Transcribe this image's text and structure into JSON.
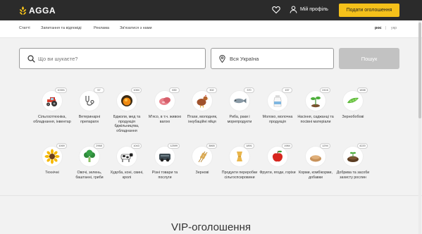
{
  "header": {
    "logo_text": "AGGA",
    "profile_label": "Мій профіль",
    "post_button": "Подати оголошення"
  },
  "subnav": {
    "links": [
      "Статті",
      "Запитання та відповіді",
      "Реклама",
      "Зв'язатися з нами"
    ],
    "languages": [
      "рос",
      "укр"
    ],
    "active_language": "рос"
  },
  "search": {
    "placeholder": "Що ви шукаєте?",
    "region_label": "Вся Україна",
    "find_button": "Пошук"
  },
  "colors": {
    "accent": "#f5c11a",
    "topbar": "#2b2b2b",
    "page_background": "#f2f2f2",
    "search_button_disabled": "#c2c2c2"
  },
  "categories": [
    {
      "label": "Сільгосптехніка, обладнання, інвентар",
      "count": "10301",
      "icon": "tractor-icon"
    },
    {
      "label": "Ветеринарні препарати",
      "count": "57",
      "icon": "stethoscope-icon"
    },
    {
      "label": "Бджоли, мед та продукція бджільництва, обладнання",
      "count": "1084",
      "icon": "honey-icon"
    },
    {
      "label": "М'ясо, в т.ч. живою вагою",
      "count": "830",
      "icon": "meat-icon"
    },
    {
      "label": "Птахи, молодняк, інкубаційні яйця",
      "count": "302",
      "icon": "chicken-icon"
    },
    {
      "label": "Риба, раки і морепродукти",
      "count": "370",
      "icon": "fish-icon"
    },
    {
      "label": "Молоко, молочна продукція",
      "count": "157",
      "icon": "milk-icon"
    },
    {
      "label": "Насіння, саджанці та посівні матеріали",
      "count": "2416",
      "icon": "seedling-icon"
    },
    {
      "label": "Зернобобові",
      "count": "1838",
      "icon": "peas-icon"
    },
    {
      "label": "Технічні",
      "count": "1069",
      "icon": "sunflower-icon"
    },
    {
      "label": "Овочі, зелень, баштанні, гриби",
      "count": "2968",
      "icon": "broccoli-icon"
    },
    {
      "label": "Худоба, коні, свині, кролі",
      "count": "1043",
      "icon": "cow-icon"
    },
    {
      "label": "Різні товари та послуги",
      "count": "12599",
      "icon": "services-icon"
    },
    {
      "label": "Зернові",
      "count": "3865",
      "icon": "wheat-icon"
    },
    {
      "label": "Продукти переробки сільгоспсировини",
      "count": "1891",
      "icon": "pasta-icon"
    },
    {
      "label": "Фрукти, ягоди, горіхи",
      "count": "1984",
      "icon": "apple-icon"
    },
    {
      "label": "Корми, комбікорми, добавки",
      "count": "1294",
      "icon": "feed-icon"
    },
    {
      "label": "Добрива та засоби захисту рослин",
      "count": "4220",
      "icon": "fertilizer-icon"
    }
  ],
  "vip": {
    "title": "VIP-оголошення"
  }
}
